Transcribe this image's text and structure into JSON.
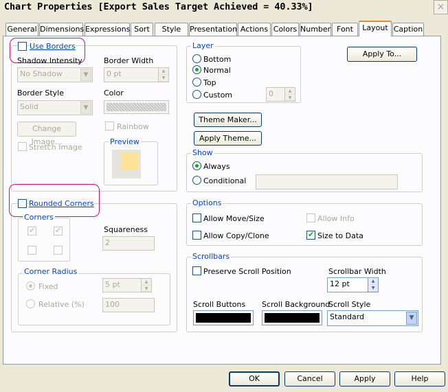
{
  "window": {
    "title": "Chart Properties [Export Sales Target  Achieved = 40.33%]",
    "close": "×"
  },
  "tabs": [
    "General",
    "Dimensions",
    "Expressions",
    "Sort",
    "Style",
    "Presentation",
    "Actions",
    "Colors",
    "Number",
    "Font",
    "Layout",
    "Caption"
  ],
  "active_tab": "Layout",
  "borders": {
    "use_borders": "Use Borders",
    "shadow_intensity_label": "Shadow Intensity",
    "shadow_intensity": "No Shadow",
    "border_width_label": "Border Width",
    "border_width": "0 pt",
    "border_style_label": "Border Style",
    "border_style": "Solid",
    "color_label": "Color",
    "change_image": "Change Image...",
    "rainbow": "Rainbow",
    "stretch_image": "Stretch Image",
    "preview": "Preview"
  },
  "rounded": {
    "rounded_corners": "Rounded Corners",
    "corners": "Corners",
    "squareness_label": "Squareness",
    "squareness": "2",
    "corner_radius": "Corner Radius",
    "fixed": "Fixed",
    "fixed_value": "5 pt",
    "relative": "Relative (%)",
    "relative_value": "100"
  },
  "layer": {
    "title": "Layer",
    "bottom": "Bottom",
    "normal": "Normal",
    "top": "Top",
    "custom": "Custom",
    "custom_value": "0"
  },
  "buttons": {
    "apply_to": "Apply To...",
    "theme_maker": "Theme Maker...",
    "apply_theme": "Apply Theme...",
    "ok": "OK",
    "cancel": "Cancel",
    "apply": "Apply",
    "help": "Help"
  },
  "show": {
    "title": "Show",
    "always": "Always",
    "conditional": "Conditional"
  },
  "options": {
    "title": "Options",
    "allow_move": "Allow Move/Size",
    "allow_info": "Allow Info",
    "allow_copy": "Allow Copy/Clone",
    "size_to_data": "Size to Data"
  },
  "scrollbars": {
    "title": "Scrollbars",
    "preserve": "Preserve Scroll Position",
    "width_label": "Scrollbar Width",
    "width": "12 pt",
    "buttons_label": "Scroll Buttons",
    "background_label": "Scroll Background",
    "style_label": "Scroll Style",
    "style": "Standard"
  }
}
